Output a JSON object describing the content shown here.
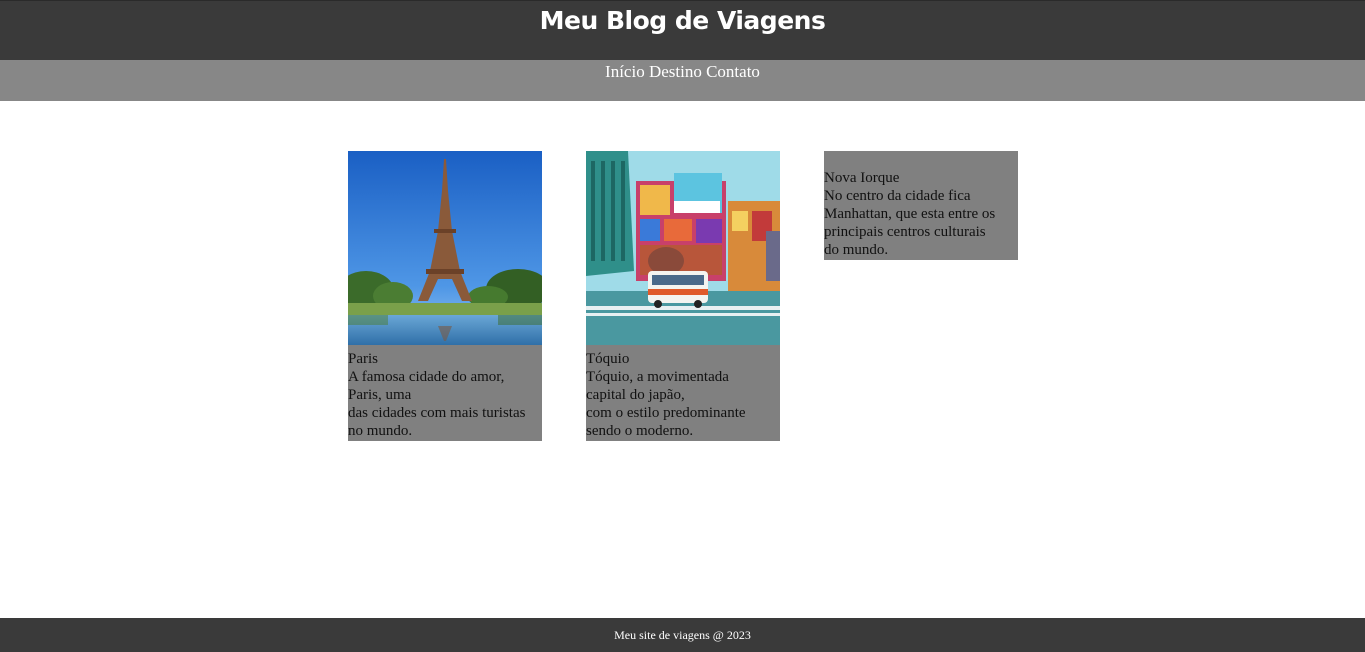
{
  "header": {
    "title": "Meu Blog de Viagens"
  },
  "nav": {
    "items": [
      {
        "label": "Início"
      },
      {
        "label": "Destino"
      },
      {
        "label": "Contato"
      }
    ]
  },
  "cards": [
    {
      "title": "Paris",
      "desc_lines": [
        "A famosa cidade do amor,",
        "Paris, uma",
        "das cidades com mais turistas",
        "no mundo."
      ],
      "image": "eiffel-tower-photo"
    },
    {
      "title": "Tóquio",
      "desc_lines": [
        "Tóquio, a movimentada",
        "capital do japão,",
        "com o estilo predominante",
        "sendo o moderno."
      ],
      "image": "tokyo-street-photo"
    },
    {
      "title": "Nova Iorque",
      "desc_lines": [
        "No centro da cidade fica",
        "Manhattan, que esta entre os",
        "principais centros culturais",
        "do mundo."
      ]
    }
  ],
  "footer": {
    "text": "Meu site de viagens @ 2023"
  },
  "colors": {
    "header_bg": "#3a3a3a",
    "nav_bg": "#878787",
    "card_bg": "#808080",
    "footer_bg": "#3a3a3a"
  }
}
